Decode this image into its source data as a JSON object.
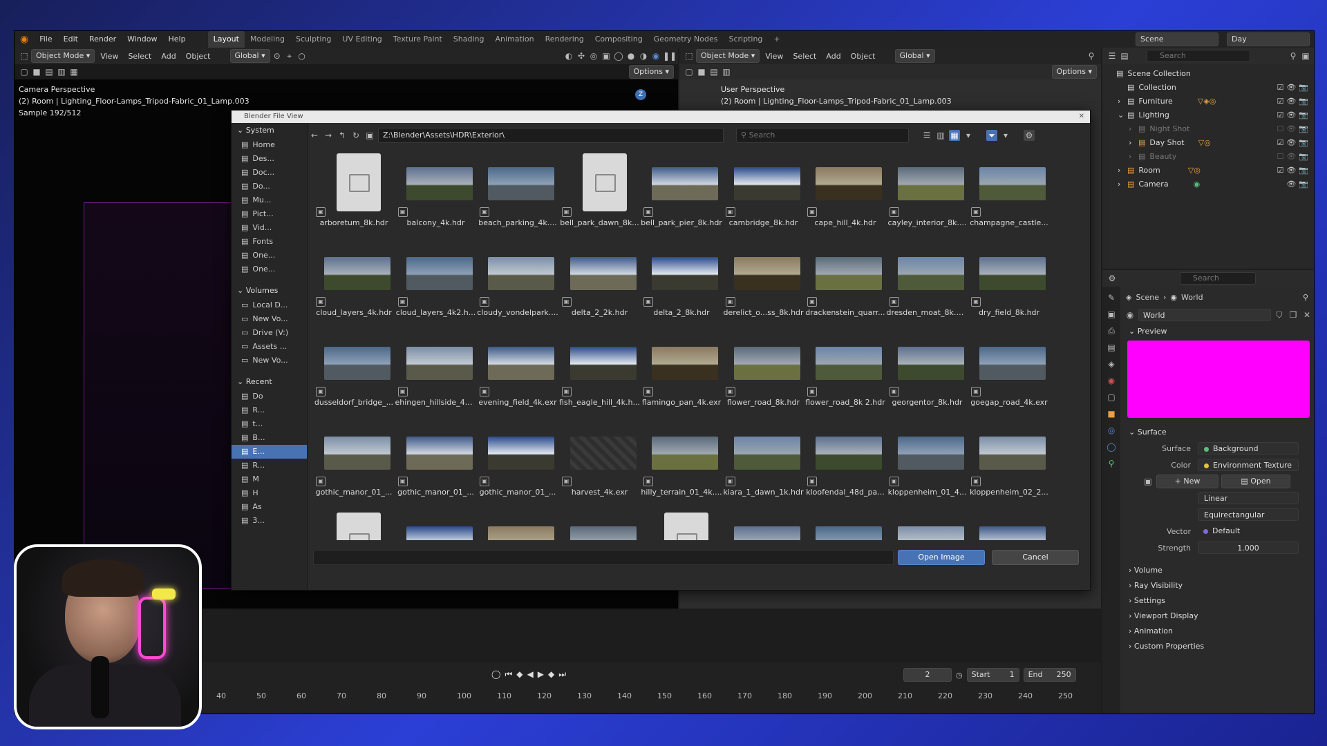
{
  "menu": {
    "items": [
      "File",
      "Edit",
      "Render",
      "Window",
      "Help"
    ]
  },
  "workspaces": {
    "tabs": [
      "Layout",
      "Modeling",
      "Sculpting",
      "UV Editing",
      "Texture Paint",
      "Shading",
      "Animation",
      "Rendering",
      "Compositing",
      "Geometry Nodes",
      "Scripting"
    ],
    "active": "Layout"
  },
  "topright": {
    "scene": "Scene",
    "view_layer": "Day"
  },
  "viewport_left": {
    "mode": "Object Mode",
    "menus": [
      "View",
      "Select",
      "Add",
      "Object"
    ],
    "orientation": "Global",
    "options": "Options",
    "overlay": [
      "Camera Perspective",
      "(2) Room | Lighting_Floor-Lamps_Tripod-Fabric_01_Lamp.003",
      "Sample 192/512"
    ]
  },
  "viewport_right": {
    "mode": "Object Mode",
    "menus": [
      "View",
      "Select",
      "Add",
      "Object"
    ],
    "orientation": "Global",
    "options": "Options",
    "overlay": [
      "User Perspective",
      "(2) Room | Lighting_Floor-Lamps_Tripod-Fabric_01_Lamp.003"
    ]
  },
  "file_browser": {
    "title": "Blender File View",
    "path": "Z:\\Blender\\Assets\\HDR\\Exterior\\",
    "search_placeholder": "Search",
    "sections": {
      "system": {
        "label": "System",
        "items": [
          "Home",
          "Des...",
          "Doc...",
          "Do...",
          "Mu...",
          "Pict...",
          "Vid...",
          "Fonts",
          "One...",
          "One..."
        ]
      },
      "volumes": {
        "label": "Volumes",
        "items": [
          "Local D...",
          "New Vo...",
          "Drive (V:)",
          "Assets ...",
          "New Vo..."
        ]
      },
      "recent": {
        "label": "Recent",
        "items": [
          "Do",
          "R...",
          "t...",
          "B...",
          "E...",
          "R...",
          "M",
          "H",
          "As",
          "3..."
        ]
      }
    },
    "files": [
      "arboretum_8k.hdr",
      "balcony_4k.hdr",
      "beach_parking_4k....",
      "bell_park_dawn_8k...",
      "bell_park_pier_8k.hdr",
      "cambridge_8k.hdr",
      "cape_hill_4k.hdr",
      "cayley_interior_8k....",
      "champagne_castle...",
      "cloud_layers_4k.hdr",
      "cloud_layers_4k2.h...",
      "cloudy_vondelpark....",
      "delta_2_2k.hdr",
      "delta_2_8k.hdr",
      "derelict_o...ss_8k.hdr",
      "drackenstein_quarr...",
      "dresden_moat_8k.h...",
      "dry_field_8k.hdr",
      "dusseldorf_bridge_...",
      "ehingen_hillside_4k...",
      "evening_field_4k.exr",
      "fish_eagle_hill_4k.h...",
      "flamingo_pan_4k.exr",
      "flower_road_8k.hdr",
      "flower_road_8k 2.hdr",
      "georgentor_8k.hdr",
      "goegap_road_4k.exr",
      "gothic_manor_01_...",
      "gothic_manor_01_...",
      "gothic_manor_01_...",
      "harvest_4k.exr",
      "hilly_terrain_01_4k....",
      "kiara_1_dawn_1k.hdr",
      "kloofendal_48d_pa...",
      "kloppenheim_01_4...",
      "kloppenheim_02_2...",
      "",
      "",
      "",
      "",
      "",
      "",
      "",
      "",
      ""
    ],
    "doc_icons": [
      0,
      3,
      36,
      40
    ],
    "open_label": "Open Image",
    "cancel_label": "Cancel"
  },
  "outliner": {
    "search_placeholder": "Search",
    "rows": [
      "Scene Collection",
      "Collection",
      "Furniture",
      "Lighting",
      "Night Shot",
      "Day Shot",
      "Beauty",
      "Room",
      "Camera"
    ]
  },
  "properties": {
    "search_placeholder": "Search",
    "breadcrumb": [
      "Scene",
      "World"
    ],
    "world_name": "World",
    "sections": {
      "preview": "Preview",
      "surface": "Surface"
    },
    "surface_label": "Surface",
    "surface_value": "Background",
    "color_label": "Color",
    "color_value": "Environment Texture",
    "new_label": "New",
    "open_label": "Open",
    "interp": "Linear",
    "projection": "Equirectangular",
    "vector_label": "Vector",
    "vector_value": "Default",
    "strength_label": "Strength",
    "strength_value": "1.000",
    "collapsed": [
      "Volume",
      "Ray Visibility",
      "Settings",
      "Viewport Display",
      "Animation",
      "Custom Properties"
    ],
    "preview_color": "#ff00ff"
  },
  "timeline": {
    "current": "2",
    "start_label": "Start",
    "start": "1",
    "end_label": "End",
    "end": "250",
    "ticks": [
      "40",
      "50",
      "60",
      "70",
      "80",
      "90",
      "100",
      "110",
      "120",
      "130",
      "140",
      "150",
      "160",
      "170",
      "180",
      "190",
      "200",
      "210",
      "220",
      "230",
      "240",
      "250"
    ]
  }
}
